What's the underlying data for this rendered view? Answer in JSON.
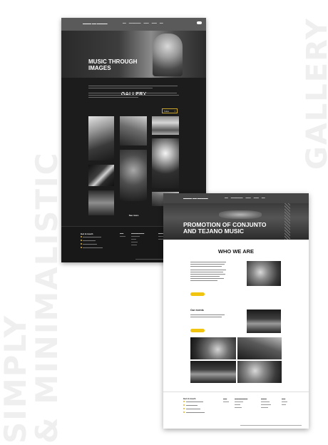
{
  "background": {
    "side_word": "GALLERY",
    "tagline_line1": "SIMPLY",
    "tagline_line2": "& MINIMALISTIC"
  },
  "dark_page": {
    "hero_title_line1": "MUSIC THROUGH",
    "hero_title_line2": "IMAGES",
    "section_title": "GALLERY",
    "filter_label": "Todas",
    "see_more_label": "See more",
    "footer_title": "Get in touch"
  },
  "white_page": {
    "hero_title_line1": "PROMOTION OF CONJUNTO",
    "hero_title_line2": "AND TEJANO MUSIC",
    "section_title": "WHO WE ARE",
    "events_heading": "Our events",
    "footer_title": "Get in touch"
  },
  "colors": {
    "accent": "#f1c40f",
    "dark_bg": "#1c1c1c"
  }
}
